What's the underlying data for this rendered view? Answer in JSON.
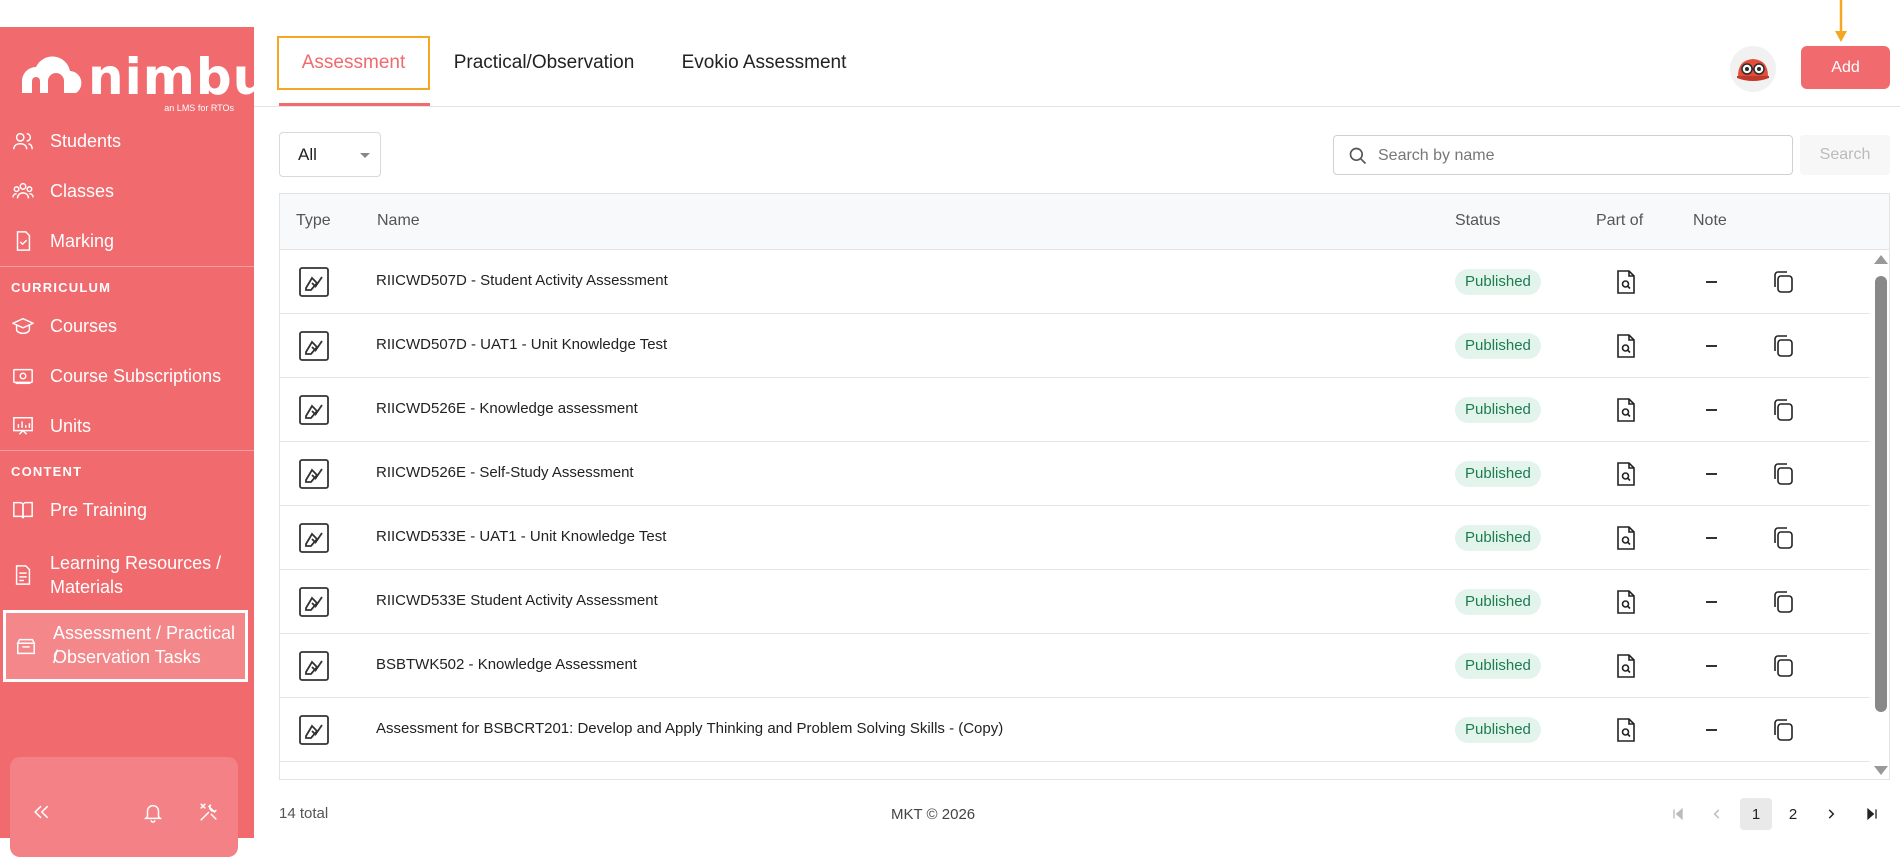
{
  "app": {
    "brand": "nimbu",
    "tagline": "an LMS for RTOs"
  },
  "sidebar": {
    "items_top": [
      {
        "label": "Students",
        "icon": "users-icon"
      },
      {
        "label": "Classes",
        "icon": "group-icon"
      },
      {
        "label": "Marking",
        "icon": "clipboard-check-icon"
      }
    ],
    "section_curriculum": "CURRICULUM",
    "items_curriculum": [
      {
        "label": "Courses",
        "icon": "graduation-cap-icon"
      },
      {
        "label": "Course Subscriptions",
        "icon": "subscription-icon"
      },
      {
        "label": "Units",
        "icon": "presentation-chart-icon"
      }
    ],
    "section_content": "CONTENT",
    "items_content": [
      {
        "label": "Pre Training",
        "icon": "book-open-icon"
      },
      {
        "label_line1": "Learning Resources /",
        "label_line2": "Materials",
        "icon": "document-icon"
      },
      {
        "label_line1": "Assessment / Practical /",
        "label_line2": "Observation Tasks",
        "icon": "archive-icon",
        "active": true
      }
    ],
    "footer_icons": [
      "collapse-icon",
      "bell-icon",
      "tools-icon"
    ]
  },
  "header": {
    "tabs": [
      {
        "label": "Assessment",
        "active": true
      },
      {
        "label": "Practical/Observation"
      },
      {
        "label": "Evokio Assessment"
      }
    ],
    "add_label": "Add"
  },
  "toolbar": {
    "filter_value": "All",
    "search_placeholder": "Search by name",
    "search_label": "Search"
  },
  "table": {
    "columns": [
      "Type",
      "Name",
      "Status",
      "Part of",
      "Note"
    ],
    "rows": [
      {
        "name": "RIICWD507D - Student Activity Assessment",
        "status": "Published"
      },
      {
        "name": "RIICWD507D - UAT1 - Unit Knowledge Test",
        "status": "Published"
      },
      {
        "name": "RIICWD526E - Knowledge assessment",
        "status": "Published"
      },
      {
        "name": "RIICWD526E - Self-Study Assessment",
        "status": "Published"
      },
      {
        "name": "RIICWD533E - UAT1 - Unit Knowledge Test",
        "status": "Published"
      },
      {
        "name": "RIICWD533E Student Activity Assessment",
        "status": "Published"
      },
      {
        "name": "BSBTWK502 - Knowledge Assessment",
        "status": "Published"
      },
      {
        "name": "Assessment for BSBCRT201: Develop and Apply Thinking and Problem Solving Skills - (Copy)",
        "status": "Published"
      }
    ]
  },
  "footer": {
    "total": "14 total",
    "copyright": "MKT © 2026",
    "pages": [
      "1",
      "2"
    ],
    "current_page": "1"
  },
  "colors": {
    "brand": "#f06a6e",
    "highlight": "#f5a623",
    "published_bg": "#e3f4ec",
    "published_text": "#1c7d4f"
  }
}
